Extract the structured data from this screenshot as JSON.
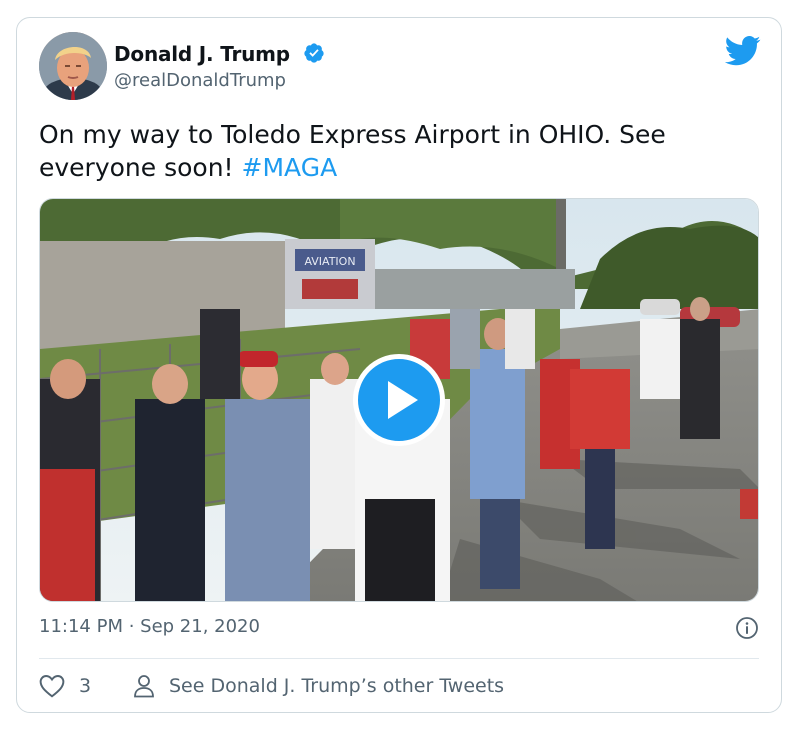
{
  "author": {
    "name": "Donald J. Trump",
    "handle": "@realDonaldTrump",
    "verified": true
  },
  "tweet": {
    "text_line1": "On my way to Toledo Express Airport in OHIO. See",
    "text_line2_prefix": "everyone soon! ",
    "hashtag": "#MAGA",
    "timestamp": "11:14 PM · Sep 21, 2020"
  },
  "media": {
    "type": "video",
    "sign_text": "AVIATION"
  },
  "actions": {
    "like_count": "3",
    "other_tweets_label": "See Donald J. Trump’s other Tweets"
  },
  "colors": {
    "accent": "#1d9bf0",
    "secondary_text": "#536471",
    "border": "#cfd9de"
  },
  "icons": {
    "verified": "verified-badge-icon",
    "brand": "twitter-bird-icon",
    "play": "play-icon",
    "info": "info-icon",
    "like": "heart-icon",
    "profile": "person-icon"
  }
}
